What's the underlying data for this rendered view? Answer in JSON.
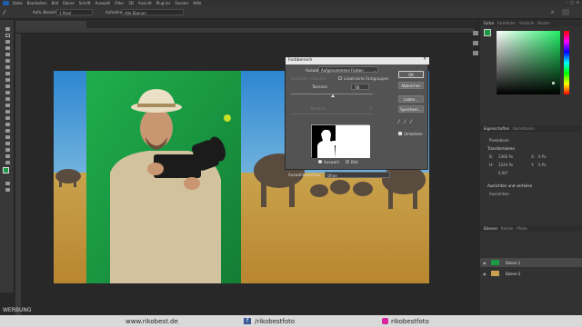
{
  "menu": [
    "Datei",
    "Bearbeiten",
    "Bild",
    "Ebene",
    "Schrift",
    "Auswahl",
    "Filter",
    "3D",
    "Ansicht",
    "Plug-ins",
    "Fenster",
    "Hilfe"
  ],
  "options": {
    "size_label": "Aufn.-Bereich:",
    "size_value": "1 Pixel",
    "sample_label": "Aufnahme:",
    "sample_value": "Alle Ebenen"
  },
  "doc_tab": "Steff-park.jpg bei 23,2% (Ebene 1, RGB/8#) *",
  "dialog": {
    "title": "Farbbereich",
    "select_label": "Auswahl:",
    "select_value": "Aufgenommene Farben",
    "clusters_label": "Lokalisierte Farbgruppen",
    "detect_faces_label": "Gesichter erkennen",
    "tolerance_label": "Toleranz:",
    "tolerance_value": "78",
    "range_label": "Bereich:",
    "range_value": "%",
    "radio_selection": "Auswahl",
    "radio_image": "Bild",
    "preview_label": "Auswahlvorschau:",
    "preview_value": "Ohne",
    "btn_ok": "OK",
    "btn_cancel": "Abbrechen",
    "btn_load": "Laden...",
    "btn_save": "Speichern...",
    "invert_label": "Umkehren"
  },
  "panels": {
    "color_tabs": [
      "Farbe",
      "Farbfelder",
      "Verläufe",
      "Muster"
    ],
    "props_tabs": [
      "Eigenschaften",
      "Korrekturen"
    ],
    "props_type": "Pixelebene",
    "transform_label": "Transformieren",
    "w_label": "B:",
    "w_value": "3366 Px",
    "h_label": "H:",
    "h_value": "2244 Px",
    "x_label": "X:",
    "x_value": "0 Px",
    "y_label": "Y:",
    "y_value": "0 Px",
    "angle_value": "0,00°",
    "align_label": "Ausrichten und verteilen",
    "align_sub": "Ausrichten:",
    "layers_tabs": [
      "Ebenen",
      "Kanäle",
      "Pfade"
    ],
    "layer1": "Ebene 1",
    "layer2": "Ebene 2"
  },
  "watermark": "WERBUNG",
  "footer": {
    "site": "www.rikobest.de",
    "fb": "/rikobestfoto",
    "ig": "rikobestfoto"
  },
  "colors": {
    "accent_green": "#1a9a43",
    "sky": "#3a8fd1",
    "grass": "#c9a050"
  }
}
